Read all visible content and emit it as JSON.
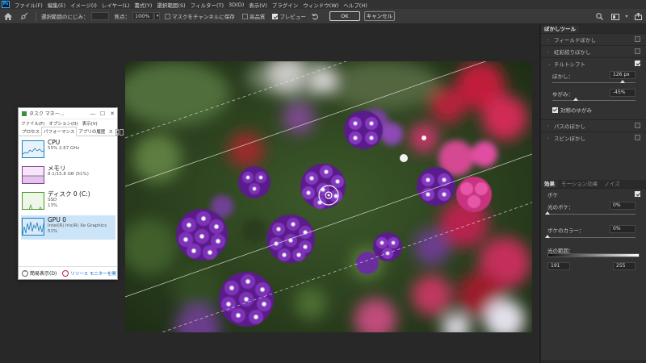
{
  "app": {
    "logo": "Ps"
  },
  "menu": [
    "ファイル(F)",
    "編集(E)",
    "イメージ(I)",
    "レイヤー(L)",
    "書式(Y)",
    "選択範囲(S)",
    "フィルター(T)",
    "3D(D)",
    "表示(V)",
    "プラグイン",
    "ウィンドウ(W)",
    "ヘルプ(H)"
  ],
  "options": {
    "edge_blur_label": "選択範囲のにじみ：",
    "edge_blur_value": "",
    "focus_label": "焦点：",
    "focus_value": "100%",
    "save_mask_label": "マスクをチャンネルに保存",
    "high_quality_label": "高品質",
    "preview_label": "プレビュー",
    "ok_label": "OK",
    "cancel_label": "キャンセル"
  },
  "task_manager": {
    "title": "タスク マネー...",
    "menu": [
      "ファイル(F)",
      "オプション(O)",
      "表示(V)"
    ],
    "tabs": [
      "プロセス",
      "パフォーマンス",
      "アプリの履歴",
      "ス"
    ],
    "active_tab": "パフォーマンス",
    "items": [
      {
        "name": "CPU",
        "detail1": "55%  2.67 GHz",
        "detail2": "",
        "color": "#1a7fc1",
        "fill": "#e8f2fa"
      },
      {
        "name": "メモリ",
        "detail1": "8.1/15.8 GB (51%)",
        "detail2": "",
        "color": "#8b3b9f",
        "fill": "#f4e8f7"
      },
      {
        "name": "ディスク 0 (C:)",
        "detail1": "SSD",
        "detail2": "13%",
        "color": "#4c9a2a",
        "fill": "#eef6e9"
      },
      {
        "name": "GPU 0",
        "detail1": "Intel(R) Iris(R) Xe Graphics",
        "detail2": "51%",
        "color": "#1a7fc1",
        "fill": "#dbeaf6"
      }
    ],
    "fewer_details": "簡易表示(D)",
    "resource_monitor": "リソース モニターを開"
  },
  "blur_gallery": {
    "tab_label": "ぼかしツール",
    "items": [
      {
        "label": "フィールドぼかし",
        "checked": false
      },
      {
        "label": "虹彩絞りぼかし",
        "checked": false
      },
      {
        "label": "チルトシフト",
        "checked": true
      }
    ],
    "blur_label": "ぼかし：",
    "blur_value": "126 px",
    "blur_level": 0.84,
    "distortion_label": "ゆがみ：",
    "distortion_value": "-45%",
    "distortion_level": 0.28,
    "symmetric_label": "対称のゆがみ",
    "more_items": [
      {
        "label": "パスのぼかし",
        "checked": false
      },
      {
        "label": "スピンぼかし",
        "checked": false
      }
    ]
  },
  "effects": {
    "tabs": [
      "効果",
      "モーション効果",
      "ノイズ"
    ],
    "bokeh_label": "ボケ",
    "bokeh_checked": true,
    "light_bokeh_label": "光のボケ：",
    "light_bokeh_value": "0%",
    "light_bokeh_level": 0,
    "bokeh_color_label": "ボケのカラー：",
    "bokeh_color_value": "0%",
    "bokeh_color_level": 0,
    "light_range_label": "光の範囲：",
    "light_range_low": "191",
    "light_range_high": "255"
  }
}
